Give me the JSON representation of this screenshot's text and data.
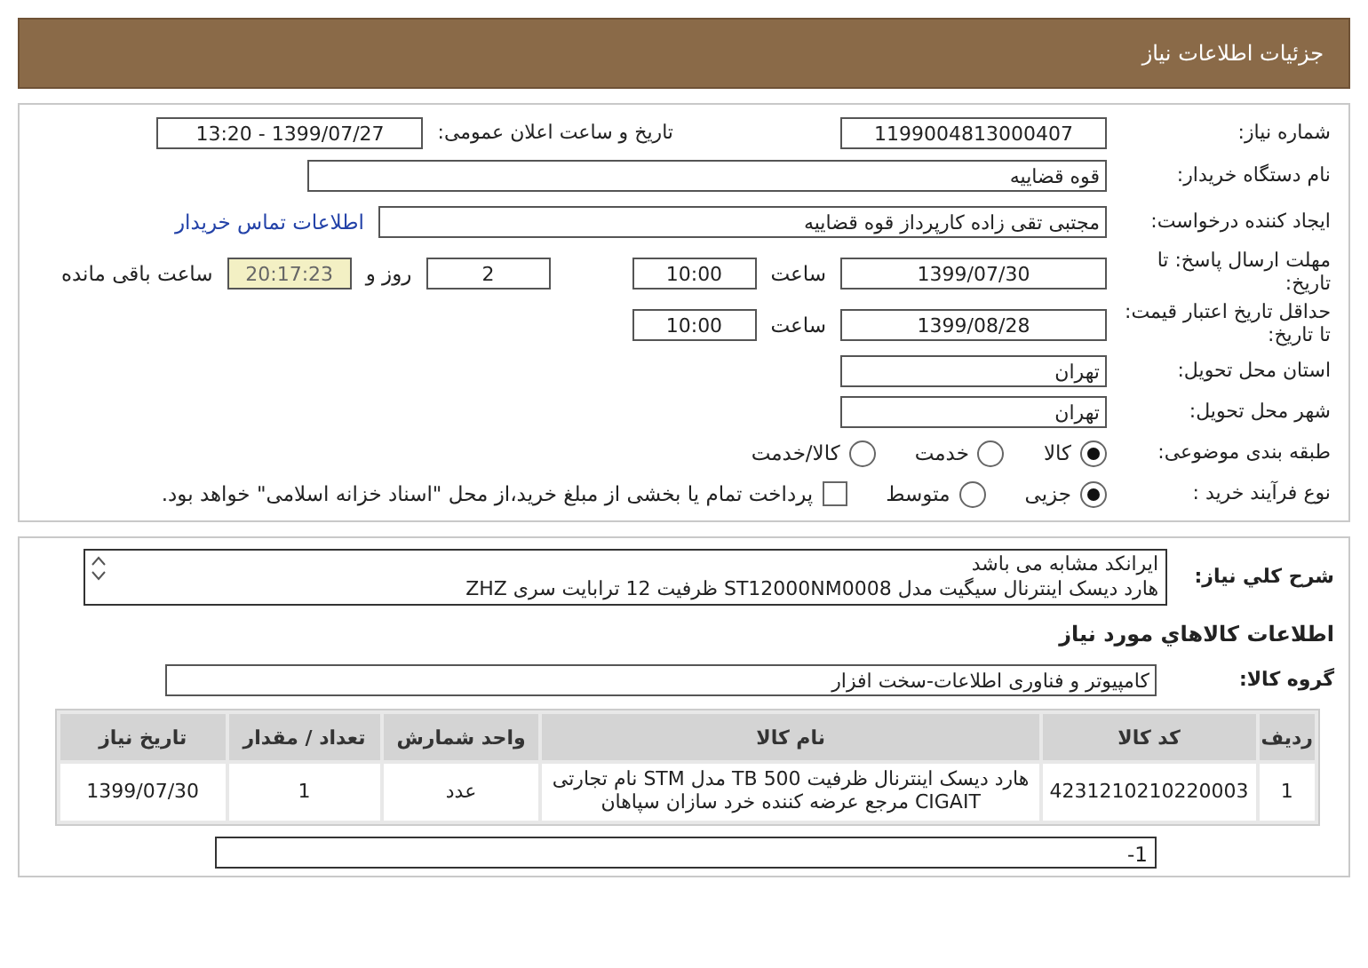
{
  "header": {
    "title": "جزئیات اطلاعات نیاز"
  },
  "need_number": {
    "label": "شماره نیاز:",
    "value": "1199004813000407"
  },
  "announce": {
    "label": "تاریخ و ساعت اعلان عمومی:",
    "value": "1399/07/27 - 13:20"
  },
  "buyer_org": {
    "label": "نام دستگاه خریدار:",
    "value": "قوه قضاییه"
  },
  "creator": {
    "label": "ایجاد کننده درخواست:",
    "value": "مجتبی تقی زاده کارپرداز قوه قضاییه",
    "link": "اطلاعات تماس خریدار"
  },
  "deadline": {
    "label": "مهلت ارسال پاسخ: تا تاریخ:",
    "date": "1399/07/30",
    "time_label": "ساعت",
    "time": "10:00",
    "days": "2",
    "days_label": "روز و",
    "remaining": "20:17:23",
    "remaining_label": "ساعت باقی مانده"
  },
  "validity": {
    "label": "حداقل تاریخ اعتبار قیمت: تا تاریخ:",
    "date": "1399/08/28",
    "time_label": "ساعت",
    "time": "10:00"
  },
  "province": {
    "label": "استان محل تحویل:",
    "value": "تهران"
  },
  "city": {
    "label": "شهر محل تحویل:",
    "value": "تهران"
  },
  "category": {
    "label": "طبقه بندی موضوعی:",
    "options": [
      {
        "label": "کالا",
        "selected": true
      },
      {
        "label": "خدمت",
        "selected": false
      },
      {
        "label": "کالا/خدمت",
        "selected": false
      }
    ]
  },
  "process": {
    "label": "نوع فرآیند خرید :",
    "options": [
      {
        "label": "جزیی",
        "selected": true
      },
      {
        "label": "متوسط",
        "selected": false
      }
    ],
    "treasury": {
      "label": "پرداخت تمام یا بخشی از مبلغ خرید،از محل \"اسناد خزانه اسلامی\" خواهد بود.",
      "checked": false
    }
  },
  "description": {
    "label": "شرح کلي نياز:",
    "lines": [
      "ایرانکد مشابه می باشد",
      "هارد دیسک اینترنال سیگیت مدل ST12000NM0008 ظرفیت 12 ترابایت سری ZHZ"
    ]
  },
  "goods_heading": "اطلاعات کالاهاي مورد نياز",
  "goods_group": {
    "label": "گروه کالا:",
    "value": "کامپیوتر و فناوری اطلاعات-سخت افزار"
  },
  "table": {
    "columns": [
      "ردیف",
      "کد کالا",
      "نام کالا",
      "واحد شمارش",
      "تعداد / مقدار",
      "تاریخ نیاز"
    ],
    "rows": [
      [
        "1",
        "4231210210220003",
        "هارد دیسک اینترنال ظرفیت 500 TB مدل STM نام تجارتی CIGAIT مرجع عرضه کننده خرد سازان سپاهان",
        "عدد",
        "1",
        "1399/07/30"
      ]
    ]
  },
  "notes": {
    "text": "1-"
  }
}
